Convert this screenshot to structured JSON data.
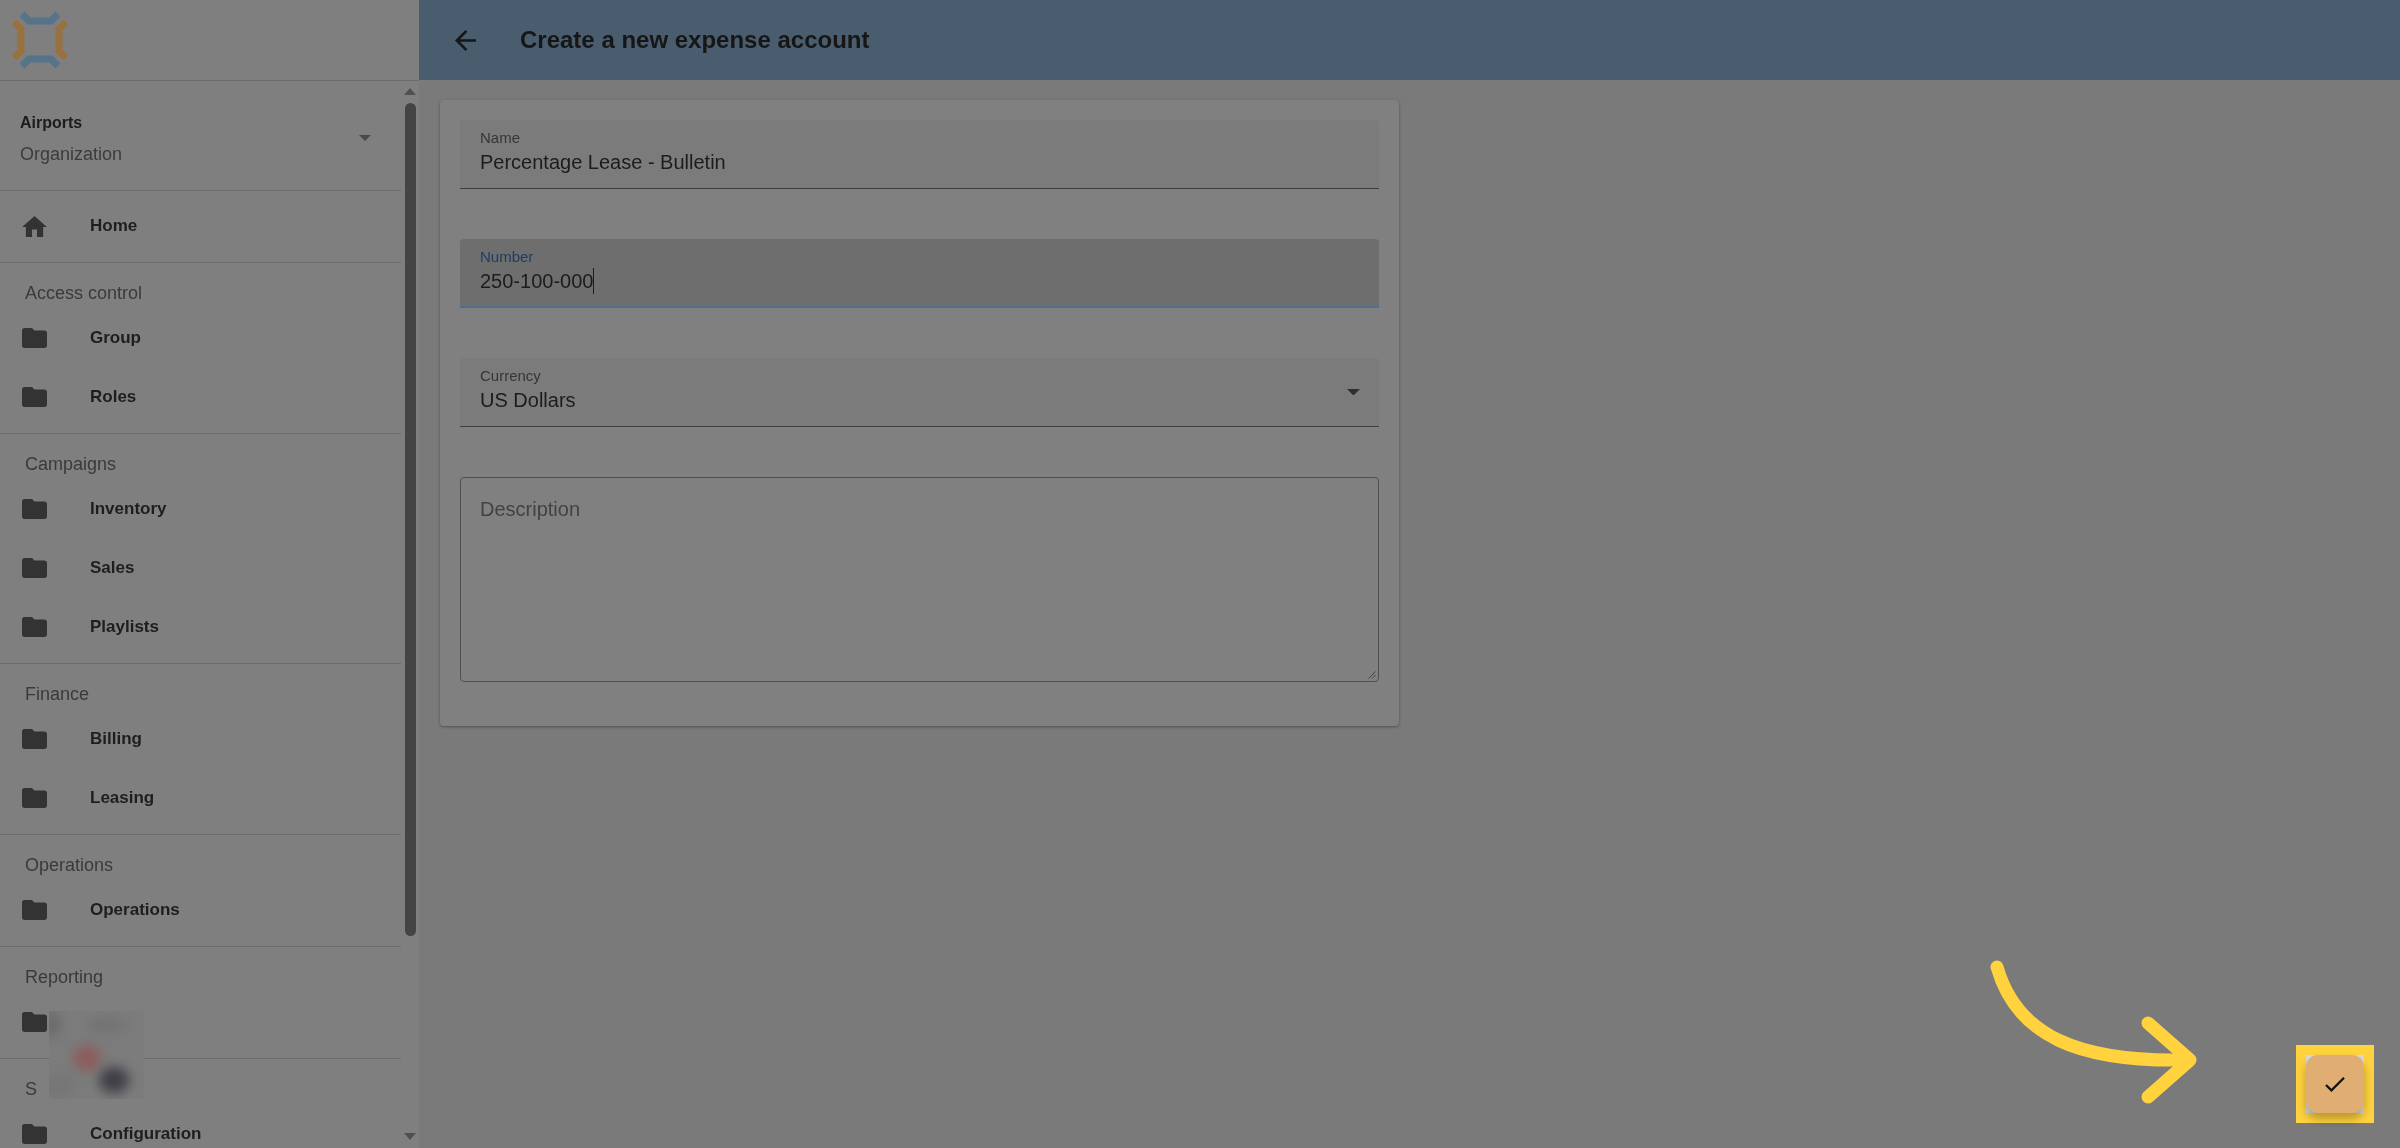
{
  "sidebar": {
    "organization": {
      "name": "Airports",
      "subtitle": "Organization"
    },
    "sections": [
      {
        "items": [
          {
            "kind": "home",
            "label": "Home",
            "blurred": false
          }
        ]
      },
      {
        "heading": "Access control",
        "items": [
          {
            "kind": "folder",
            "label": "Group",
            "blurred": false
          },
          {
            "kind": "folder",
            "label": "Roles",
            "blurred": false
          }
        ]
      },
      {
        "heading": "Campaigns",
        "items": [
          {
            "kind": "folder",
            "label": "Inventory",
            "blurred": false
          },
          {
            "kind": "folder",
            "label": "Sales",
            "blurred": false
          },
          {
            "kind": "folder",
            "label": "Playlists",
            "blurred": false
          }
        ]
      },
      {
        "heading": "Finance",
        "items": [
          {
            "kind": "folder",
            "label": "Billing",
            "blurred": false
          },
          {
            "kind": "folder",
            "label": "Leasing",
            "blurred": false
          }
        ]
      },
      {
        "heading": "Operations",
        "items": [
          {
            "kind": "folder",
            "label": "Operations",
            "blurred": false
          }
        ]
      },
      {
        "heading": "Reporting",
        "items": [
          {
            "kind": "folder",
            "blurred": true
          }
        ]
      },
      {
        "heading": "S",
        "items": [
          {
            "kind": "folder",
            "label": "Configuration",
            "blurred": false
          }
        ]
      }
    ]
  },
  "header": {
    "title": "Create a new expense account"
  },
  "form": {
    "fields": [
      {
        "kind": "text",
        "label": "Name",
        "value": "Percentage Lease - Bulletin",
        "focused": false
      },
      {
        "kind": "text",
        "label": "Number",
        "value": "250-100-000",
        "focused": true
      },
      {
        "kind": "select",
        "label": "Currency",
        "value": "US Dollars",
        "focused": false
      },
      {
        "kind": "textarea",
        "placeholder": "Description",
        "focused": false
      }
    ]
  },
  "save_button": {
    "highlighted": true
  }
}
